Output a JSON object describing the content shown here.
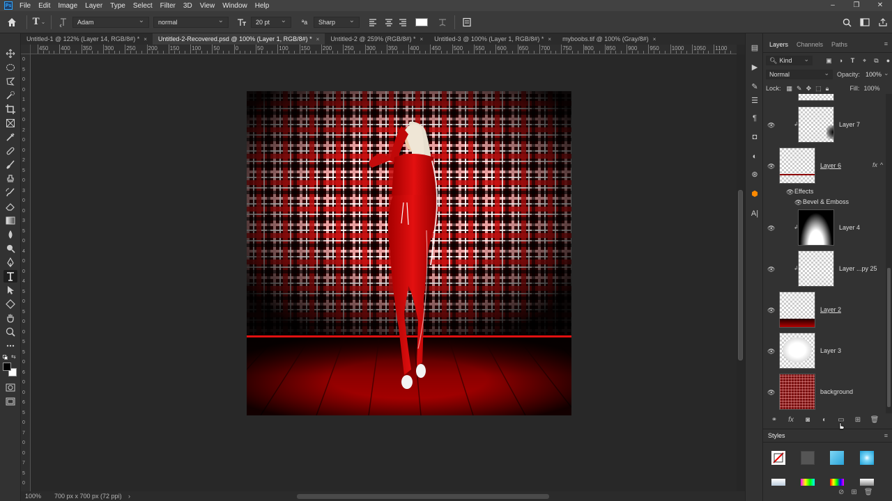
{
  "app": {
    "logo": "Ps"
  },
  "menu": [
    "File",
    "Edit",
    "Image",
    "Layer",
    "Type",
    "Select",
    "Filter",
    "3D",
    "View",
    "Window",
    "Help"
  ],
  "window_controls": [
    "–",
    "❐",
    "✕"
  ],
  "options": {
    "font_family": "Adam",
    "font_style": "normal",
    "font_size": "20 pt",
    "antialias_icon": "ªa",
    "antialias": "Sharp",
    "text_tool_glyph": "T"
  },
  "doc_tabs": [
    {
      "label": "Untitled-1 @ 122% (Layer 14, RGB/8#) *",
      "close": "×",
      "active": false
    },
    {
      "label": "Untitled-2-Recovered.psd @ 100% (Layer 1, RGB/8#) *",
      "close": "×",
      "active": true
    },
    {
      "label": "Untitled-2 @ 259% (RGB/8#) *",
      "close": "×",
      "active": false
    },
    {
      "label": "Untitled-3 @ 100% (Layer 1, RGB/8#) *",
      "close": "×",
      "active": false
    },
    {
      "label": "myboobs.tif @ 100% (Gray/8#)",
      "close": "×",
      "active": false
    }
  ],
  "ruler": {
    "h_labels": [
      "450",
      "400",
      "350",
      "300",
      "250",
      "200",
      "150",
      "100",
      "50",
      "0",
      "50",
      "100",
      "150",
      "200",
      "250",
      "300",
      "350",
      "400",
      "450",
      "500",
      "550",
      "600",
      "650",
      "700",
      "750",
      "800",
      "850",
      "900",
      "950",
      "1000",
      "1050",
      "1100"
    ],
    "v_labels": [
      "0",
      "5",
      "0",
      "0",
      "1",
      "5",
      "0",
      "2",
      "0",
      "0",
      "2",
      "5",
      "0",
      "3",
      "0",
      "0",
      "3",
      "5",
      "0",
      "4",
      "0",
      "0",
      "4",
      "5",
      "0",
      "5",
      "0",
      "0",
      "5",
      "5",
      "0",
      "6",
      "0",
      "0",
      "6",
      "5",
      "0",
      "7",
      "0",
      "0",
      "7",
      "5",
      "0"
    ]
  },
  "status": {
    "zoom": "100%",
    "doc_info": "700 px x 700 px (72 ppi)",
    "arrow": "›"
  },
  "panels": {
    "tabs": [
      "Layers",
      "Channels",
      "Paths"
    ],
    "menu_glyph": "≡",
    "kind_label": "Kind",
    "blend_mode": "Normal",
    "opacity_label": "Opacity:",
    "opacity_value": "100%",
    "lock_label": "Lock:",
    "fill_label": "Fill:",
    "fill_value": "100%",
    "fx_badge": "fx",
    "fx_collapse": "^",
    "layers": [
      {
        "name": "Layer 7"
      },
      {
        "name": "Layer 6"
      },
      {
        "name": "Effects"
      },
      {
        "name": "Bevel & Emboss"
      },
      {
        "name": "Layer 4"
      },
      {
        "name": "Layer ...py 25"
      },
      {
        "name": "Layer 2"
      },
      {
        "name": "Layer 3"
      },
      {
        "name": "background"
      }
    ],
    "styles_title": "Styles"
  },
  "colors": {
    "accent": "#31a8ff",
    "dark_red": "#8b0000",
    "bright_red": "#e00000"
  }
}
